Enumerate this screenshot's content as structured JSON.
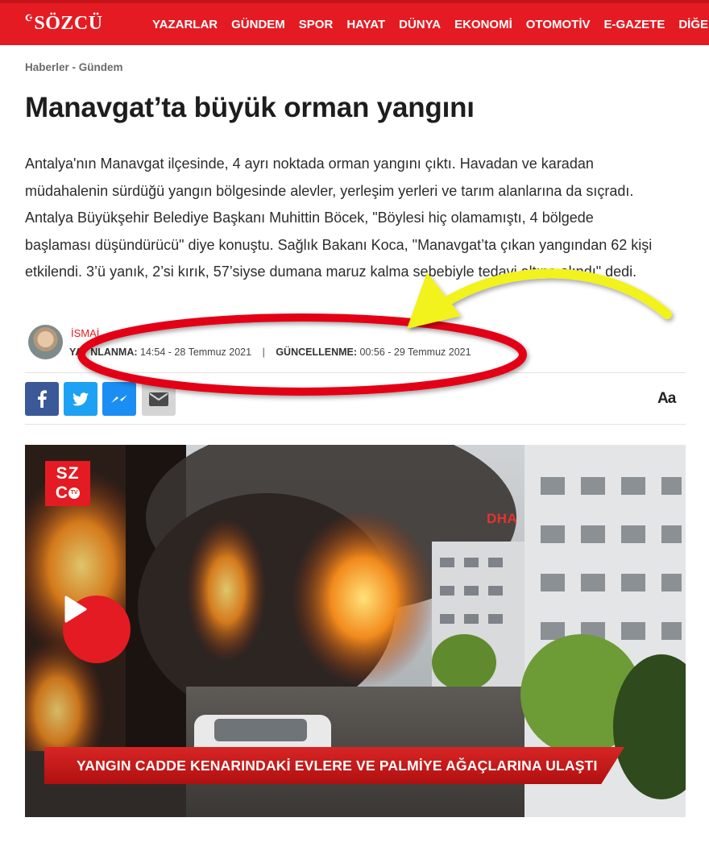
{
  "site": {
    "logo": "SÖZCÜ",
    "nav": [
      "YAZARLAR",
      "GÜNDEM",
      "SPOR",
      "HAYAT",
      "DÜNYA",
      "EKONOMİ",
      "OTOMOTİV",
      "E-GAZETE",
      "DİĞER"
    ],
    "brand_color": "#e41b22"
  },
  "article": {
    "breadcrumb": "Haberler - Gündem",
    "title": "Manavgat’ta büyük orman yangını",
    "summary": "Antalya'nın Manavgat ilçesinde, 4 ayrı noktada orman yangını çıktı. Havadan ve karadan müdahalenin sürdüğü yangın bölgesinde alevler, yerleşim yerleri ve tarım alanlarına da sıçradı. Antalya Büyükşehir Belediye Başkanı Muhittin Böcek, \"Böylesi hiç olamamıştı, 4 bölgede başlaması düşündürücü\" diye konuştu. Sağlık Bakanı Koca, \"Manavgat’ta çıkan yangından 62 kişi etkilendi. 3’ü yanık, 2’si kırık, 57’siyse dumana maruz kalma sebebiyle tedavi altına alındı\" dedi.",
    "author_visible": "İSMAİ",
    "published_label_visible": "YA",
    "published_label_visible_tail": "NLANMA:",
    "published": "14:54 - 28 Temmuz 2021",
    "separator": "|",
    "updated_label": "GÜNCELLENME:",
    "updated": "00:56 - 29 Temmuz 2021"
  },
  "share": {
    "icons": [
      "facebook-icon",
      "twitter-icon",
      "messenger-icon",
      "email-icon"
    ],
    "colors": {
      "facebook": "#3b5998",
      "twitter": "#1da1f2",
      "messenger": "#1b8ef3",
      "email": "#d5d5d5"
    },
    "font_size_label": "Aa"
  },
  "video": {
    "channel_logo": [
      "SZ",
      "C"
    ],
    "channel_logo_tv": "TV",
    "agency": "DHA",
    "ticker": "YANGIN CADDE KENARINDAKİ EVLERE VE PALMİYE AĞAÇLARINA ULAŞTI"
  },
  "annotations": {
    "ellipse_color": "#e30613",
    "arrow_color": "#f2f21e"
  }
}
